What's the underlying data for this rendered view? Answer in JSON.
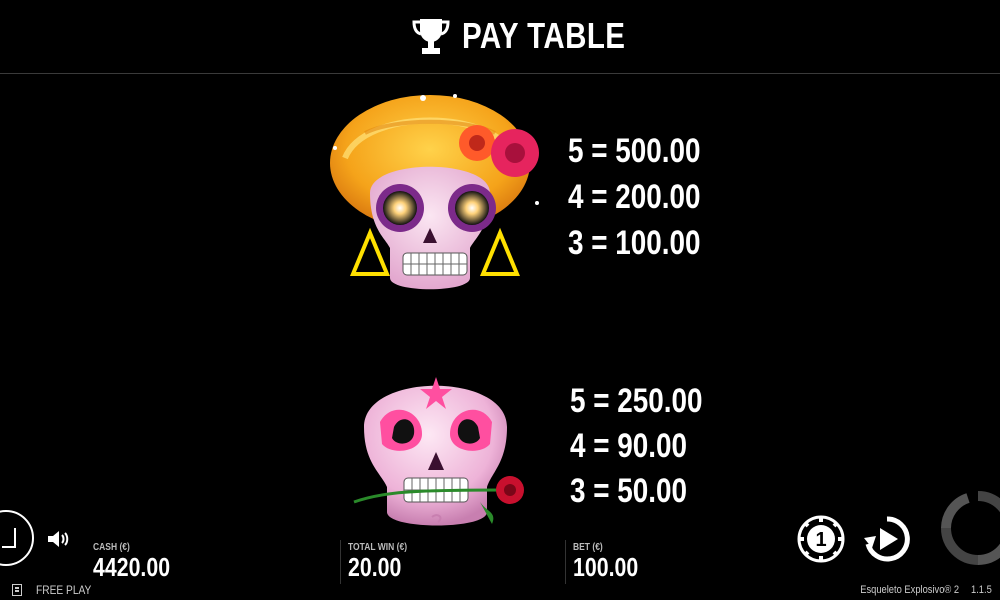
{
  "header": {
    "title": "PAY TABLE",
    "icon": "trophy-icon"
  },
  "paytable": [
    {
      "symbol": "catrina-skull-symbol",
      "payouts": [
        "5 = 500.00",
        "4 = 200.00",
        "3 = 100.00"
      ]
    },
    {
      "symbol": "pink-skull-rose-symbol",
      "payouts": [
        "5 = 250.00",
        "4 = 90.00",
        "3 = 50.00"
      ]
    }
  ],
  "bottom_bar": {
    "cash_label": "CASH (€)",
    "cash_value": "4420.00",
    "total_win_label": "TOTAL WIN (€)",
    "total_win_value": "20.00",
    "bet_label": "BET (€)",
    "bet_value": "100.00",
    "mode": "FREE PLAY",
    "game_name": "Esqueleto Explosivo® 2",
    "version": "1.1.5",
    "coin_value": "1"
  },
  "colors": {
    "background": "#000000",
    "text": "#ffffff",
    "muted": "#bbbbbb"
  }
}
